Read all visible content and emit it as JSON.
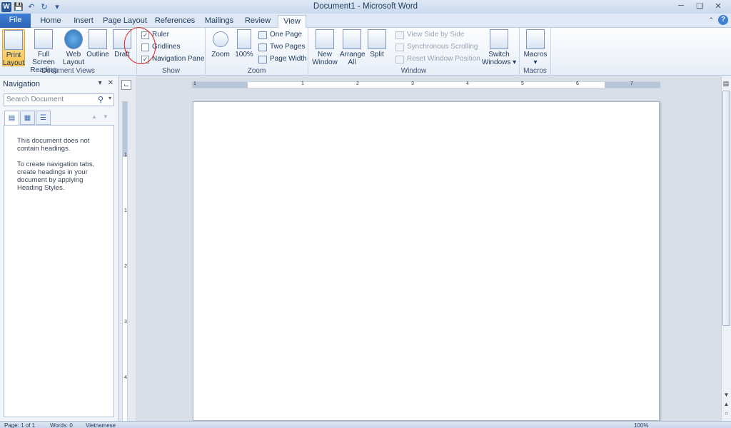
{
  "window": {
    "title": "Document1 - Microsoft Word",
    "app_icon": "W",
    "controls": [
      "minimize-icon",
      "restore-icon",
      "close-icon"
    ]
  },
  "qat": {
    "icons": [
      "save-icon",
      "undo-icon",
      "redo-icon",
      "customize-qat-icon"
    ]
  },
  "tabs": [
    {
      "label": "File"
    },
    {
      "label": "Home"
    },
    {
      "label": "Insert"
    },
    {
      "label": "Page Layout"
    },
    {
      "label": "References"
    },
    {
      "label": "Mailings"
    },
    {
      "label": "Review"
    },
    {
      "label": "View"
    }
  ],
  "active_tab": "View",
  "ribbon": {
    "document_views": {
      "label": "Document Views",
      "buttons": [
        {
          "line1": "Print",
          "line2": "Layout",
          "selected": true
        },
        {
          "line1": "Full Screen",
          "line2": "Reading"
        },
        {
          "line1": "Web",
          "line2": "Layout"
        },
        {
          "line1": "Outline",
          "line2": ""
        },
        {
          "line1": "Draft",
          "line2": ""
        }
      ]
    },
    "show": {
      "label": "Show",
      "items": [
        {
          "label": "Ruler",
          "checked": true
        },
        {
          "label": "Gridlines",
          "checked": false
        },
        {
          "label": "Navigation Pane",
          "checked": true
        }
      ]
    },
    "zoom": {
      "label": "Zoom",
      "zoom_btn": "Zoom",
      "hundred_btn": "100%",
      "one_page": "One Page",
      "two_pages": "Two Pages",
      "page_width": "Page Width"
    },
    "window": {
      "label": "Window",
      "new_window": {
        "line1": "New",
        "line2": "Window"
      },
      "arrange_all": {
        "line1": "Arrange",
        "line2": "All"
      },
      "split": "Split",
      "view_side_by_side": "View Side by Side",
      "sync_scrolling": "Synchronous Scrolling",
      "reset_position": "Reset Window Position",
      "switch_windows": {
        "line1": "Switch",
        "line2": "Windows ▾"
      }
    },
    "macros": {
      "label": "Macros",
      "button": "Macros"
    }
  },
  "navigation": {
    "title": "Navigation",
    "search_placeholder": "Search Document",
    "message1": "This document does not contain headings.",
    "message2": "To create navigation tabs, create headings in your document by applying Heading Styles."
  },
  "ruler": {
    "h_numbers": [
      "1",
      "1",
      "2",
      "3",
      "4",
      "5",
      "6",
      "7"
    ],
    "v_numbers": [
      "1",
      "1",
      "2",
      "3",
      "4"
    ]
  },
  "status": {
    "page": "Page: 1 of 1",
    "words": "Words: 0",
    "language": "Vietnamese",
    "zoom": "100%"
  },
  "colors": {
    "file_tab": "#2a64b8",
    "selected_button": "#f8c552",
    "annotation_circle": "#e02020"
  }
}
